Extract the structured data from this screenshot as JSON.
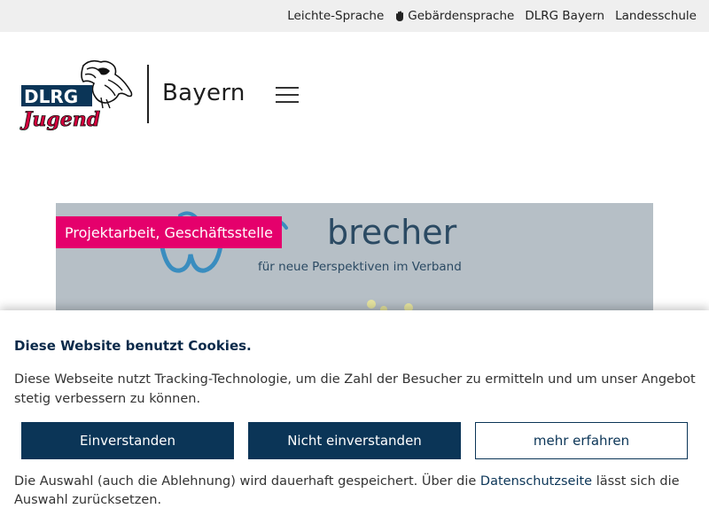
{
  "topbar": {
    "links": [
      "Leichte-Sprache",
      "Gebärdensprache",
      "DLRG Bayern",
      "Landesschule"
    ]
  },
  "header": {
    "logo_text_top": "DLRG",
    "logo_text_bottom": "Jugend",
    "region": "Bayern"
  },
  "hero": {
    "category": "Projektarbeit, Geschäftsstelle",
    "headline": "brecher",
    "subline": "für neue Perspektiven im Verband"
  },
  "cookie": {
    "title": "Diese Website benutzt Cookies.",
    "text": "Diese Webseite nutzt Tracking-Technologie, um die Zahl der Besucher zu ermitteln und um unser Angebot stetig verbessern zu können.",
    "accept_label": "Einverstanden",
    "decline_label": "Nicht einverstanden",
    "more_label": "mehr erfahren",
    "note_before": "Die Auswahl (auch die Ablehnung) wird dauerhaft gespeichert. Über die ",
    "note_link": "Datenschutzseite",
    "note_after": " lässt sich die Auswahl zurücksetzen."
  },
  "colors": {
    "accent": "#e5006c",
    "navy": "#0b3557",
    "brand_red": "#d3003c"
  }
}
